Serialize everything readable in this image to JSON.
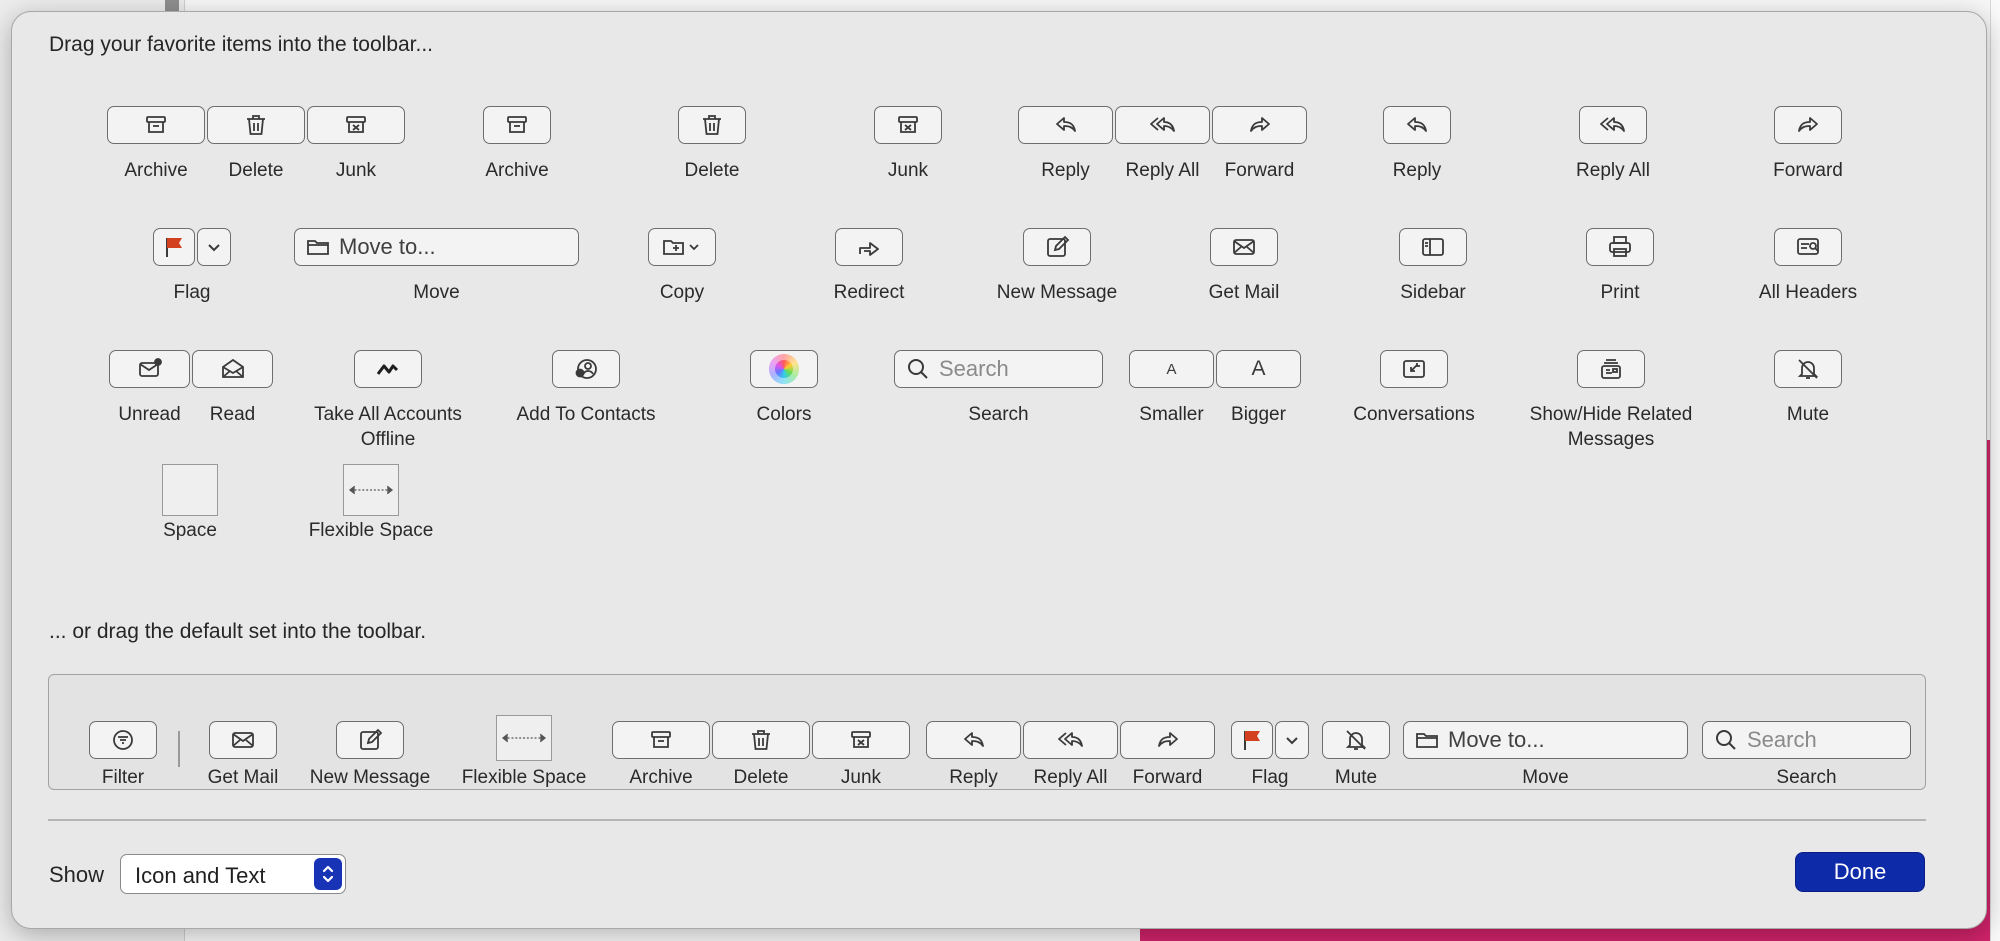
{
  "sheet": {
    "title": "Drag your favorite items into the toolbar...",
    "default_title": "... or drag the default set into the toolbar."
  },
  "palette": {
    "archive_delete_junk": {
      "labels": [
        "Archive",
        "Delete",
        "Junk"
      ]
    },
    "archive": "Archive",
    "delete": "Delete",
    "junk": "Junk",
    "reply_group": {
      "labels": [
        "Reply",
        "Reply All",
        "Forward"
      ]
    },
    "reply": "Reply",
    "reply_all": "Reply All",
    "forward": "Forward",
    "flag": "Flag",
    "move": {
      "label": "Move",
      "field": "Move to..."
    },
    "copy": "Copy",
    "redirect": "Redirect",
    "new_message": "New Message",
    "get_mail": "Get Mail",
    "sidebar": "Sidebar",
    "print": "Print",
    "all_headers": "All Headers",
    "unread_read": {
      "labels": [
        "Unread",
        "Read"
      ]
    },
    "take_offline": "Take All Accounts Offline",
    "add_contacts": "Add To Contacts",
    "colors": "Colors",
    "search": {
      "label": "Search",
      "placeholder": "Search"
    },
    "text_size": {
      "labels": [
        "Smaller",
        "Bigger"
      ],
      "glyph": "A"
    },
    "conversations": "Conversations",
    "show_hide": "Show/Hide Related Messages",
    "mute": "Mute",
    "space": "Space",
    "flexible_space": "Flexible Space"
  },
  "default_set": {
    "filter": "Filter",
    "get_mail": "Get Mail",
    "new_message": "New Message",
    "flexible_space": "Flexible Space",
    "archive_delete_junk": [
      "Archive",
      "Delete",
      "Junk"
    ],
    "reply_group": [
      "Reply",
      "Reply All",
      "Forward"
    ],
    "flag": "Flag",
    "mute": "Mute",
    "move": {
      "label": "Move",
      "field": "Move to..."
    },
    "search": {
      "label": "Search",
      "placeholder": "Search"
    }
  },
  "footer": {
    "show_label": "Show",
    "show_value": "Icon and Text",
    "done_label": "Done"
  },
  "colors": {
    "accent": "#0d2aa8",
    "flag_red": "#d2401f"
  }
}
